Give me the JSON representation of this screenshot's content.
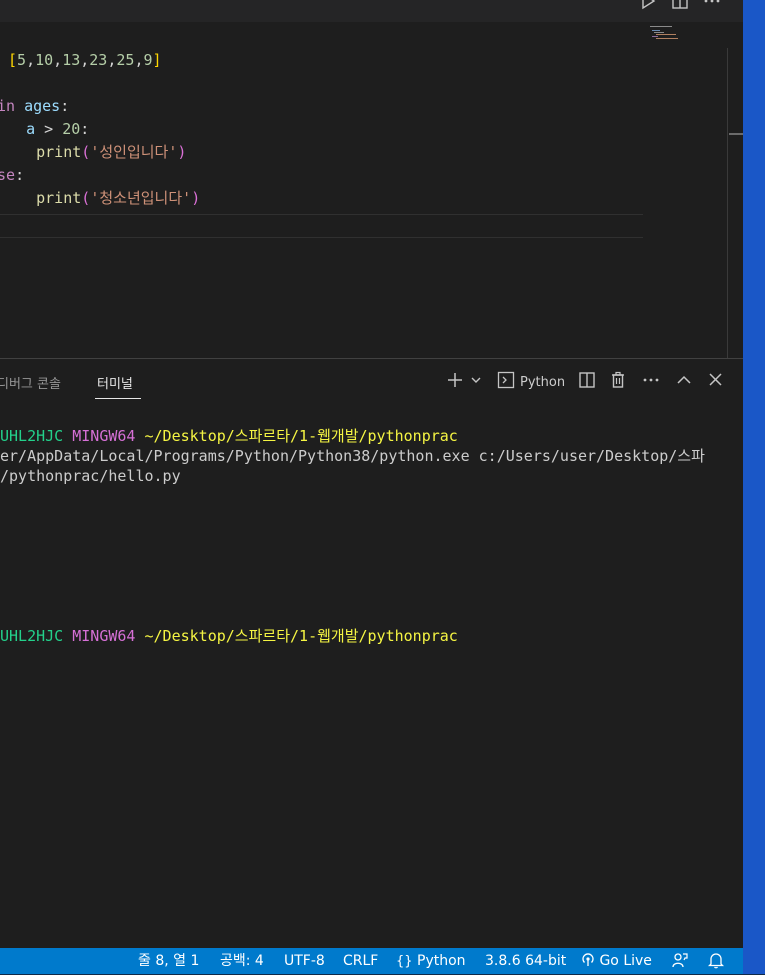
{
  "editor": {
    "lines": [
      [
        {
          "t": "[",
          "c": "t-yellow"
        },
        {
          "t": "5",
          "c": "t-num"
        },
        {
          "t": ",",
          "c": "t-white"
        },
        {
          "t": "10",
          "c": "t-num"
        },
        {
          "t": ",",
          "c": "t-white"
        },
        {
          "t": "13",
          "c": "t-num"
        },
        {
          "t": ",",
          "c": "t-white"
        },
        {
          "t": "23",
          "c": "t-num"
        },
        {
          "t": ",",
          "c": "t-white"
        },
        {
          "t": "25",
          "c": "t-num"
        },
        {
          "t": ",",
          "c": "t-white"
        },
        {
          "t": "9",
          "c": "t-num"
        },
        {
          "t": "]",
          "c": "t-yellow"
        }
      ],
      [],
      [
        {
          "t": "in",
          "c": "t-kw"
        },
        {
          "t": " ",
          "c": "t-white"
        },
        {
          "t": "ages",
          "c": "t-var"
        },
        {
          "t": ":",
          "c": "t-white"
        }
      ],
      [
        {
          "t": "  ",
          "c": "t-white"
        },
        {
          "t": "a",
          "c": "t-var"
        },
        {
          "t": " > ",
          "c": "t-white"
        },
        {
          "t": "20",
          "c": "t-num"
        },
        {
          "t": ":",
          "c": "t-white"
        }
      ],
      [
        {
          "t": "    ",
          "c": "t-white"
        },
        {
          "t": "print",
          "c": "t-fn"
        },
        {
          "t": "(",
          "c": "t-pink"
        },
        {
          "t": "'성인입니다'",
          "c": "t-str"
        },
        {
          "t": ")",
          "c": "t-pink"
        }
      ],
      [
        {
          "t": "se",
          "c": "t-kw"
        },
        {
          "t": ":",
          "c": "t-white"
        }
      ],
      [
        {
          "t": "    ",
          "c": "t-white"
        },
        {
          "t": "print",
          "c": "t-fn"
        },
        {
          "t": "(",
          "c": "t-pink"
        },
        {
          "t": "'청소년입니다'",
          "c": "t-str"
        },
        {
          "t": ")",
          "c": "t-pink"
        }
      ]
    ]
  },
  "panel": {
    "tab_debug_console": "디버그 콘솔",
    "tab_terminal": "터미널",
    "terminal_profile": "Python",
    "terminal_lines": [
      [
        {
          "t": "UHL2HJC ",
          "c": "c-green"
        },
        {
          "t": "MINGW64 ",
          "c": "c-magenta"
        },
        {
          "t": "~/Desktop/스파르타/1-웹개발/pythonprac",
          "c": "c-yellow"
        }
      ],
      [
        {
          "t": "er/AppData/Local/Programs/Python/Python38/python.exe c:/Users/user/Desktop/스파",
          "c": "c-white"
        }
      ],
      [
        {
          "t": "/pythonprac/hello.py",
          "c": "c-white"
        }
      ],
      [
        {
          "t": "UHL2HJC ",
          "c": "c-green"
        },
        {
          "t": "MINGW64 ",
          "c": "c-magenta"
        },
        {
          "t": "~/Desktop/스파르타/1-웹개발/pythonprac",
          "c": "c-yellow"
        }
      ]
    ]
  },
  "statusbar": {
    "cursor_position": "줄 8, 열 1",
    "indentation": "공백: 4",
    "encoding": "UTF-8",
    "line_ending": "CRLF",
    "language": "Python",
    "interpreter": "3.8.6 64-bit",
    "go_live": "Go Live"
  },
  "colors": {
    "statusbar_bg": "#007acc",
    "accent_edge": "#1a57c7",
    "editor_bg": "#1e1e1e"
  },
  "icons": [
    "run-icon",
    "split-editor-icon",
    "more-icon",
    "add-terminal-icon",
    "chevron-down-icon",
    "terminal-icon",
    "split-terminal-icon",
    "trash-icon",
    "maximize-panel-icon",
    "close-panel-icon",
    "braces-icon",
    "broadcast-icon",
    "feedback-icon",
    "bell-icon"
  ]
}
